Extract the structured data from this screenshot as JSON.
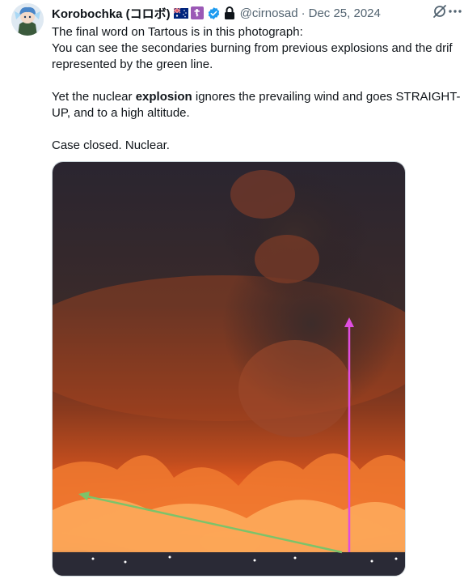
{
  "author": {
    "name": "Korobochka (コロボ)",
    "handle": "@cirnosad",
    "separator": "·",
    "date": "Dec 25, 2024",
    "cross_glyph": "☦"
  },
  "post": {
    "line1": "The final word on Tartous is in this photograph:",
    "line2": "You can see the secondaries burning from previous explosions and the drif",
    "line3": "represented by the green line.",
    "line4_pre": "Yet the nuclear ",
    "line4_bold": "explosion",
    "line4_post": " ignores the prevailing wind and goes STRAIGHT-",
    "line5": "UP, and to a high altitude.",
    "line6": "Case closed. Nuclear."
  },
  "icons": {
    "verified": "verified-badge-icon",
    "lock": "lock-icon",
    "grok": "grok-icon",
    "more": "more-icon"
  },
  "colors": {
    "arrow_green": "#7cc36a",
    "arrow_magenta": "#e04ee0",
    "verified_blue": "#1d9bf0"
  }
}
